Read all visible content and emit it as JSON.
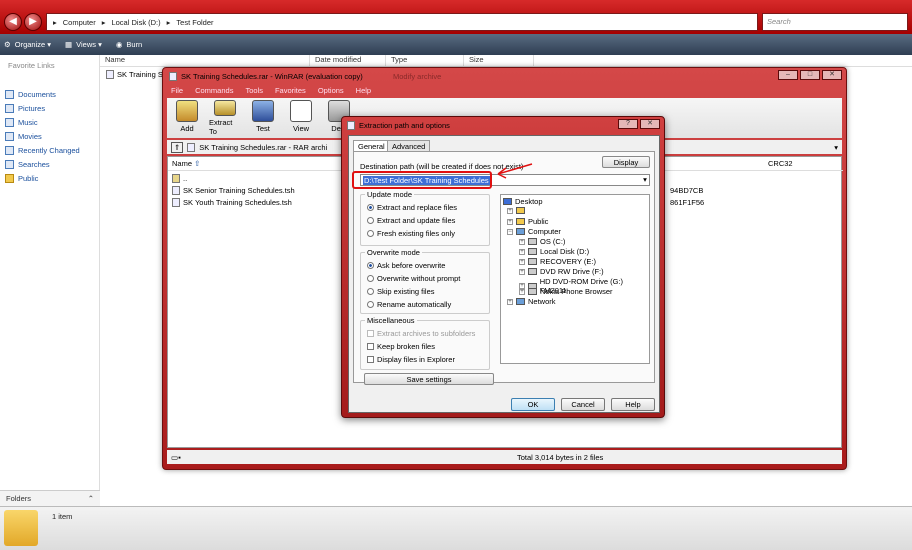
{
  "explorer": {
    "nav": {
      "back": "◀",
      "forward": "▶"
    },
    "breadcrumb": [
      "Computer",
      "Local Disk (D:)",
      "Test Folder"
    ],
    "search_placeholder": "Search",
    "toolbar": {
      "organize": "Organize ▾",
      "views": "Views ▾",
      "burn": "Burn"
    },
    "sidebar": {
      "title": "Favorite Links",
      "items": [
        "Documents",
        "Pictures",
        "Music",
        "Movies",
        "Recently Changed",
        "Searches",
        "Public"
      ],
      "folders": "Folders"
    },
    "columns": [
      "Name",
      "Date modified",
      "Type",
      "Size"
    ],
    "file": "SK Training S",
    "status": "1 item"
  },
  "winrar": {
    "title": "SK Training Schedules.rar - WinRAR (evaluation copy)",
    "ghost_title": "Modify archive",
    "menu": [
      "File",
      "Commands",
      "Tools",
      "Favorites",
      "Options",
      "Help"
    ],
    "tools": [
      "Add",
      "Extract To",
      "Test",
      "View",
      "Dele"
    ],
    "path": "SK Training Schedules.rar - RAR archi",
    "columns": {
      "name": "Name",
      "crc": "CRC32"
    },
    "files": [
      {
        "name": "..",
        "crc": ""
      },
      {
        "name": "SK Senior Training Schedules.tsh",
        "crc": "94BD7CB"
      },
      {
        "name": "SK Youth Training Schedules.tsh",
        "crc": "861F1F56"
      }
    ],
    "status": "Total 3,014 bytes in 2 files"
  },
  "dialog": {
    "title": "Extraction path and options",
    "tabs": [
      "General",
      "Advanced"
    ],
    "dest_label": "Destination path (will be created if does not exist)",
    "dest_value": "D:\\Test Folder\\SK Training Schedules",
    "display_button": "Display",
    "update_mode": {
      "title": "Update mode",
      "options": [
        "Extract and replace files",
        "Extract and update files",
        "Fresh existing files only"
      ],
      "selected": 0
    },
    "overwrite_mode": {
      "title": "Overwrite mode",
      "options": [
        "Ask before overwrite",
        "Overwrite without prompt",
        "Skip existing files",
        "Rename automatically"
      ],
      "selected": 0
    },
    "misc": {
      "title": "Miscellaneous",
      "options": [
        "Extract archives to subfolders",
        "Keep broken files",
        "Display files in Explorer"
      ]
    },
    "save_button": "Save settings",
    "tree": [
      "Desktop",
      "",
      "Public",
      "Computer",
      "OS (C:)",
      "Local Disk (D:)",
      "RECOVERY (E:)",
      "DVD RW Drive (F:)",
      "HD DVD-ROM Drive (G:) FM2011",
      "Nokia Phone Browser",
      "Network"
    ],
    "buttons": {
      "ok": "OK",
      "cancel": "Cancel",
      "help": "Help"
    }
  },
  "colors": {
    "accent": "#c42d2d",
    "selection": "#3d6ed6",
    "annotation": "#e01010"
  }
}
